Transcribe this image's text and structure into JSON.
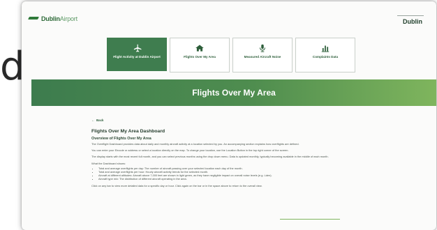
{
  "overlay": {
    "letter": "d"
  },
  "header": {
    "logo_bold": "Dublin",
    "logo_light": "Airport",
    "location": "Dublin"
  },
  "tiles": [
    {
      "label": "Flight Activity at Dublin Airport",
      "icon": "airplane-icon",
      "active": true
    },
    {
      "label": "Flights Over My Area",
      "icon": "home-icon",
      "active": false
    },
    {
      "label": "Measured Aircraft Noise",
      "icon": "microphone-icon",
      "active": false
    },
    {
      "label": "Complaints Data",
      "icon": "bar-chart-icon",
      "active": false
    }
  ],
  "banner": {
    "title": "Flights Over My Area"
  },
  "content": {
    "back": "Back",
    "heading": "Flights Over My Area Dashboard",
    "subheading": "Overview of Flights Over My Area",
    "para1": "The Overflight Dashboard provides data about daily and monthly aircraft activity at a location selected by you. An accompanying section explains how overflights are defined.",
    "para2": "You can enter your Eircode or address or select a location directly on the map. To change your location, use the Location Button in the top right corner of the screen.",
    "para3": "The display starts with the most recent full month, and you can select previous months using the drop down menu. Data is updated monthly, typically becoming available in the middle of each month.",
    "list_intro": "What the Dashboard shows:",
    "bullets": [
      "Total and average overflights per day: The number of aircraft passing over your selected location each day of the month.",
      "Total and average overflights per hour: Hourly aircraft activity trends for the selected month.",
      "Aircraft at different altitudes: Aircraft above 7,000 feet are shown in light green, as they have negligible impact on overall noise levels (e.g. Lden).",
      "Aircraft type mix: The distribution of different aircraft operating in the area."
    ],
    "para4": "Click on any bar to view more detailed data for a specific day or hour. Click again on the bar or in the space above to return to the overall view."
  },
  "colors": {
    "brand_green": "#3f7d4f",
    "banner_end": "#7fb55d"
  }
}
